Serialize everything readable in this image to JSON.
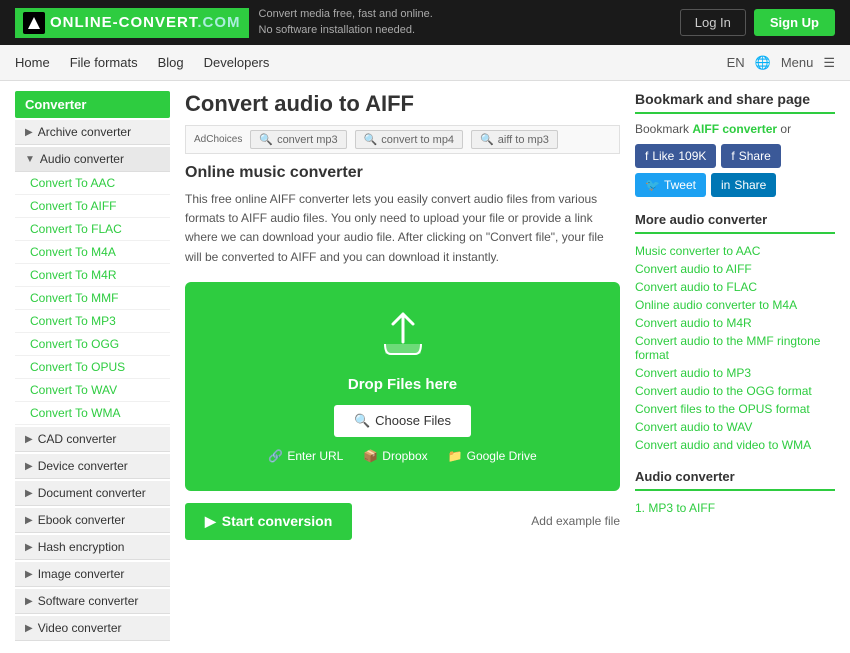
{
  "header": {
    "logo_text": "ONLINE-CONVERT",
    "logo_suffix": ".COM",
    "tagline_line1": "Convert media free, fast and online.",
    "tagline_line2": "No software installation needed.",
    "login_label": "Log In",
    "signup_label": "Sign Up"
  },
  "nav": {
    "links": [
      "Home",
      "File formats",
      "Blog",
      "Developers"
    ],
    "lang": "EN",
    "menu": "Menu"
  },
  "sidebar": {
    "heading": "Converter",
    "sections": [
      {
        "title": "Archive converter",
        "open": false,
        "items": []
      },
      {
        "title": "Audio converter",
        "open": true,
        "items": [
          "Convert To AAC",
          "Convert To AIFF",
          "Convert To FLAC",
          "Convert To M4A",
          "Convert To M4R",
          "Convert To MMF",
          "Convert To MP3",
          "Convert To OGG",
          "Convert To OPUS",
          "Convert To WAV",
          "Convert To WMA"
        ]
      },
      {
        "title": "CAD converter",
        "open": false,
        "items": []
      },
      {
        "title": "Device converter",
        "open": false,
        "items": []
      },
      {
        "title": "Document converter",
        "open": false,
        "items": []
      },
      {
        "title": "Ebook converter",
        "open": false,
        "items": []
      },
      {
        "title": "Hash encryption",
        "open": false,
        "items": []
      },
      {
        "title": "Image converter",
        "open": false,
        "items": []
      },
      {
        "title": "Software converter",
        "open": false,
        "items": []
      },
      {
        "title": "Video converter",
        "open": false,
        "items": []
      }
    ]
  },
  "content": {
    "page_title": "Convert audio to AIFF",
    "ad_label": "AdChoices",
    "ad_items": [
      {
        "label": "convert mp3",
        "icon": "🔍"
      },
      {
        "label": "convert to mp4",
        "icon": "🔍"
      },
      {
        "label": "aiff to mp3",
        "icon": "🔍"
      }
    ],
    "description_title": "Online music converter",
    "description_text": "This free online AIFF converter lets you easily convert audio files from various formats to AIFF audio files. You only need to upload your file or provide a link where we can download your audio file. After clicking on \"Convert file\", your file will be converted to AIFF and you can download it instantly.",
    "upload": {
      "drop_text": "Drop Files here",
      "choose_files": "Choose Files",
      "enter_url": "Enter URL",
      "dropbox": "Dropbox",
      "google_drive": "Google Drive"
    },
    "start_conversion": "Start conversion",
    "add_example": "Add example file"
  },
  "right_sidebar": {
    "bookmark_title": "Bookmark and share page",
    "bookmark_text": "Bookmark",
    "aiff_converter": "AIFF converter",
    "or_text": "or",
    "social": {
      "like_label": "Like",
      "like_count": "109K",
      "facebook_share": "Share",
      "tweet": "Tweet",
      "linkedin_share": "Share"
    },
    "more_converter_title": "More audio converter",
    "more_links": [
      "Music converter to AAC",
      "Convert audio to AIFF",
      "Convert audio to FLAC",
      "Online audio converter to M4A",
      "Convert audio to M4R",
      "Convert audio to the MMF ringtone format",
      "Convert audio to MP3",
      "Convert audio to the OGG format",
      "Convert files to the OPUS format",
      "Convert audio to WAV",
      "Convert audio and video to WMA"
    ],
    "audio_converter_title": "Audio converter",
    "audio_converter_items": [
      "1. MP3 to AIFF"
    ]
  }
}
